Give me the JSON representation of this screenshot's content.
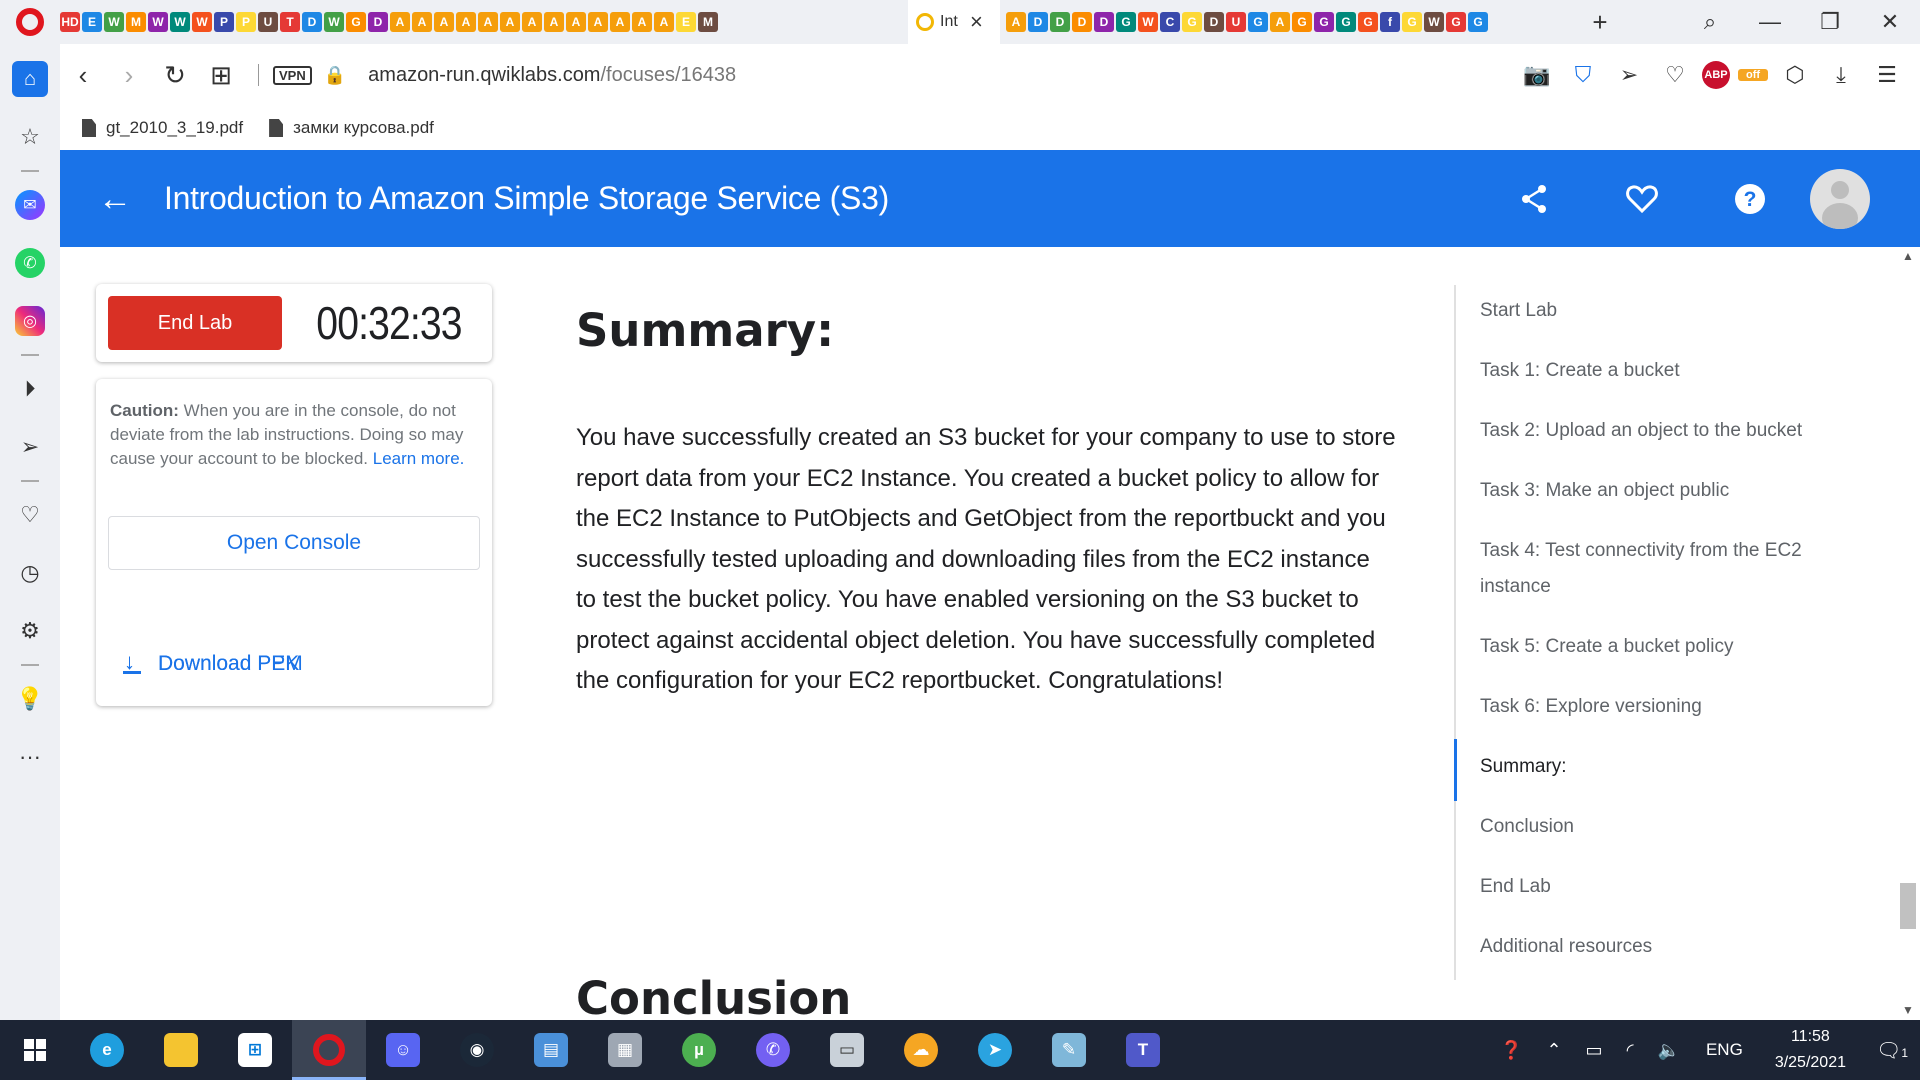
{
  "browser": {
    "active_tab_title": "Int",
    "url_host": "amazon-run.qwiklabs.com",
    "url_path": "/focuses/16438",
    "vpn_label": "VPN",
    "adblock_count": "ABP",
    "ext_off_label": "off",
    "bookmarks": [
      {
        "label": "gt_2010_3_19.pdf"
      },
      {
        "label": "замки курсова.pdf"
      }
    ],
    "tab_icons_left": [
      "HD",
      "E",
      "W",
      "M",
      "W",
      "W",
      "W",
      "P",
      "P",
      "U",
      "T",
      "D",
      "W",
      "G",
      "D",
      "A",
      "A",
      "A",
      "A",
      "A",
      "A",
      "A",
      "A",
      "A",
      "A",
      "A",
      "A",
      "A",
      "E",
      "M"
    ],
    "tab_icons_right": [
      "A",
      "D",
      "D",
      "D",
      "D",
      "G",
      "W",
      "C",
      "G",
      "D",
      "U",
      "G",
      "A",
      "G",
      "G",
      "G",
      "G",
      "f",
      "G",
      "W",
      "G",
      "G"
    ]
  },
  "lab": {
    "title": "Introduction to Amazon Simple Storage Service (S3)",
    "end_lab_label": "End Lab",
    "timer": "00:32:33",
    "caution_bold": "Caution:",
    "caution_text": " When you are in the console, do not deviate from the lab instructions. Doing so may cause your account to be blocked.",
    "learn_more": "Learn more.",
    "open_console_label": "Open Console",
    "download_pem_label": "Download PEM",
    "download_ppk_label": "Download PPK"
  },
  "content": {
    "summary_heading": "Summary:",
    "summary_body": "You have successfully created an S3 bucket for your company to use to store report data from your EC2 Instance. You created a bucket policy to allow for the EC2 Instance to PutObjects and GetObject from the reportbuckt and you successfully tested uploading and downloading files from the EC2 instance to test the bucket policy. You have enabled versioning on the S3 bucket to protect against accidental object deletion. You have successfully completed the configuration for your EC2 reportbucket. Congratulations!",
    "conclusion_heading": "Conclusion"
  },
  "toc": {
    "items": [
      {
        "label": "Start Lab"
      },
      {
        "label": "Task 1: Create a bucket"
      },
      {
        "label": "Task 2: Upload an object to the bucket"
      },
      {
        "label": "Task 3: Make an object public"
      },
      {
        "label": "Task 4: Test connectivity from the EC2 instance"
      },
      {
        "label": "Task 5: Create a bucket policy"
      },
      {
        "label": "Task 6: Explore versioning"
      },
      {
        "label": "Summary:"
      },
      {
        "label": "Conclusion"
      },
      {
        "label": "End Lab"
      },
      {
        "label": "Additional resources"
      }
    ],
    "active_item": "Summary:"
  },
  "taskbar": {
    "language": "ENG",
    "time": "11:58",
    "date": "3/25/2021",
    "notification_count": "1"
  },
  "colors": {
    "header_blue": "#1a73e8",
    "end_lab_red": "#d93025",
    "link_blue": "#1a73e8",
    "taskbar_bg": "#1c2434"
  }
}
